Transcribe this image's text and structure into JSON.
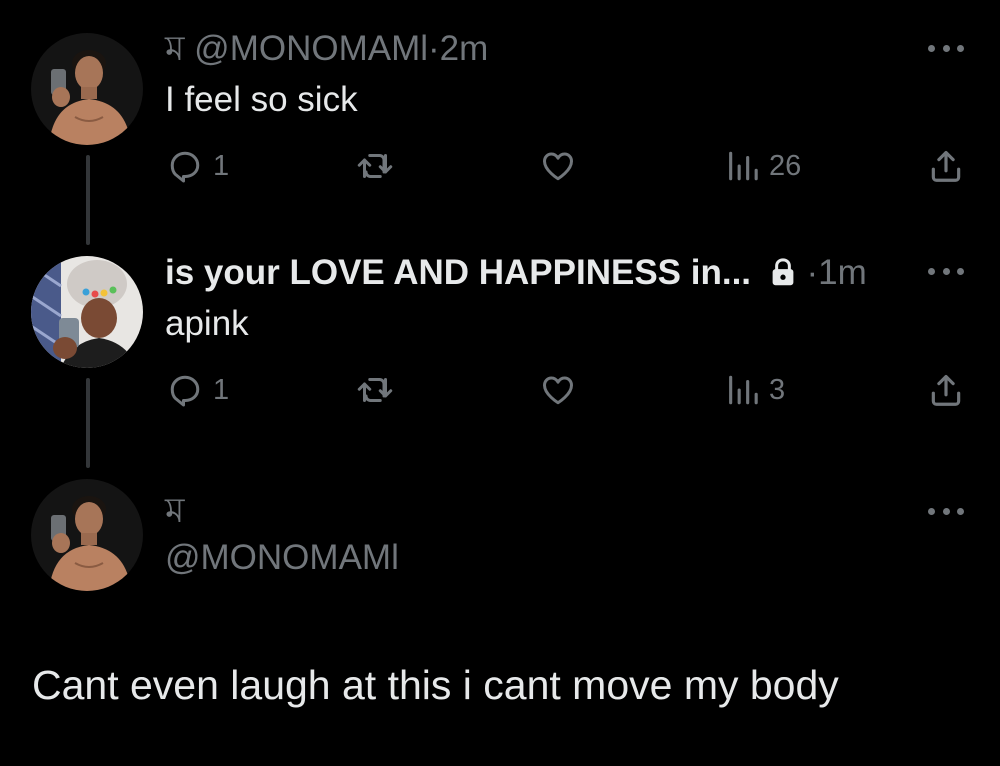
{
  "tweets": [
    {
      "display_name": "ম",
      "handle": "@MONOMAMl",
      "separator": "·",
      "time": "2m",
      "text": "I feel so sick",
      "reply_count": "1",
      "view_count": "26"
    },
    {
      "display_name": "is your LOVE AND HAPPINESS in...",
      "separator": "·",
      "time": "1m",
      "text": "apink",
      "reply_count": "1",
      "view_count": "3"
    },
    {
      "display_name": "ম",
      "handle": "@MONOMAMl",
      "text": "Cant even laugh at this i cant move my body"
    }
  ],
  "icons": {
    "reply": "reply-icon",
    "retweet": "retweet-icon",
    "like": "like-icon",
    "views": "views-icon",
    "share": "share-icon",
    "more": "more-icon",
    "lock": "lock-icon"
  },
  "colors": {
    "background": "#000000",
    "text": "#e7e9ea",
    "muted": "#71767b",
    "thread_line": "#333639"
  }
}
